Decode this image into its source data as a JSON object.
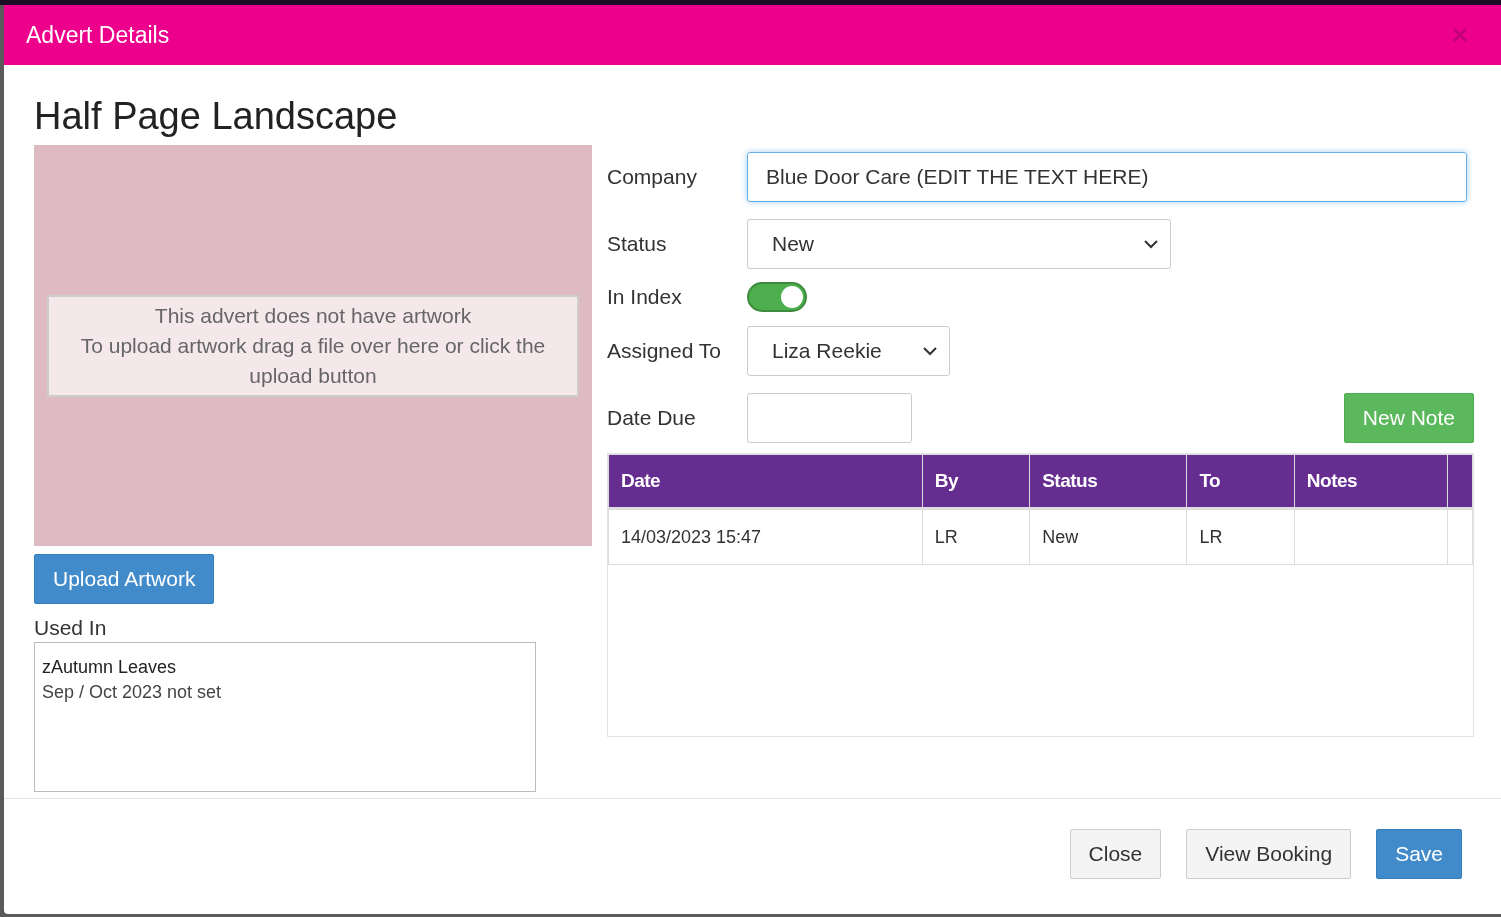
{
  "dialog": {
    "title": "Advert Details",
    "heading": "Half Page Landscape"
  },
  "artwork": {
    "message_lines": [
      "This advert does not have artwork",
      "To upload artwork drag a file over here or click the upload button"
    ],
    "upload_button": "Upload Artwork"
  },
  "used_in": {
    "label": "Used In",
    "items": [
      {
        "title": "zAutumn Leaves",
        "detail": "Sep / Oct 2023 not set"
      }
    ]
  },
  "form": {
    "fields": [
      {
        "kind": "text",
        "label": "Company",
        "value": "Blue Door Care (EDIT THE TEXT HERE)",
        "focused": true
      },
      {
        "kind": "select",
        "label": "Status",
        "value": "New"
      },
      {
        "kind": "toggle",
        "label": "In Index",
        "on": true
      },
      {
        "kind": "select",
        "label": "Assigned To",
        "value": "Liza Reekie"
      },
      {
        "kind": "date",
        "label": "Date Due"
      }
    ]
  },
  "new_note_button": "New Note",
  "notes_table": {
    "columns": [
      "Date",
      "By",
      "Status",
      "To",
      "Notes"
    ],
    "rows": [
      {
        "cells": [
          "14/03/2023 15:47",
          "LR",
          "New",
          "LR"
        ]
      }
    ]
  },
  "footer_buttons": [
    {
      "label": "Close",
      "kind": "default"
    },
    {
      "label": "View Booking",
      "kind": "default"
    },
    {
      "label": "Save",
      "kind": "primary"
    }
  ]
}
